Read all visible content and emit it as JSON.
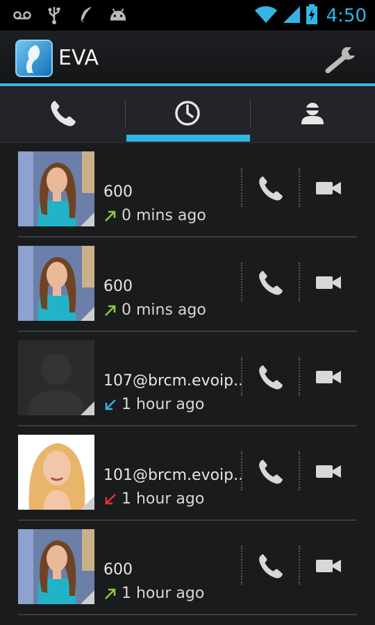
{
  "status_bar": {
    "time": "4:50",
    "icons": [
      "voicemail-icon",
      "usb-icon",
      "feather-icon",
      "android-icon",
      "wifi-icon",
      "signal-icon",
      "battery-icon"
    ]
  },
  "action_bar": {
    "title": "EVA",
    "settings_icon": "wrench-icon"
  },
  "tabs": [
    {
      "icon": "phone-icon",
      "selected": false
    },
    {
      "icon": "clock-icon",
      "selected": true
    },
    {
      "icon": "contact-icon",
      "selected": false
    }
  ],
  "colors": {
    "accent": "#33b5e5",
    "outgoing": "#8ccf3a",
    "incoming": "#33b5e5",
    "missed": "#e53333"
  },
  "call_log": [
    {
      "name": "600",
      "time": "0 mins ago",
      "direction": "outgoing",
      "avatar": "brunette"
    },
    {
      "name": "600",
      "time": "0 mins ago",
      "direction": "outgoing",
      "avatar": "brunette"
    },
    {
      "name": "107@brcm.evoip..",
      "time": "1 hour ago",
      "direction": "incoming",
      "avatar": "placeholder"
    },
    {
      "name": "101@brcm.evoip..",
      "time": "1 hour ago",
      "direction": "missed",
      "avatar": "blonde"
    },
    {
      "name": "600",
      "time": "1 hour ago",
      "direction": "outgoing",
      "avatar": "brunette"
    }
  ]
}
